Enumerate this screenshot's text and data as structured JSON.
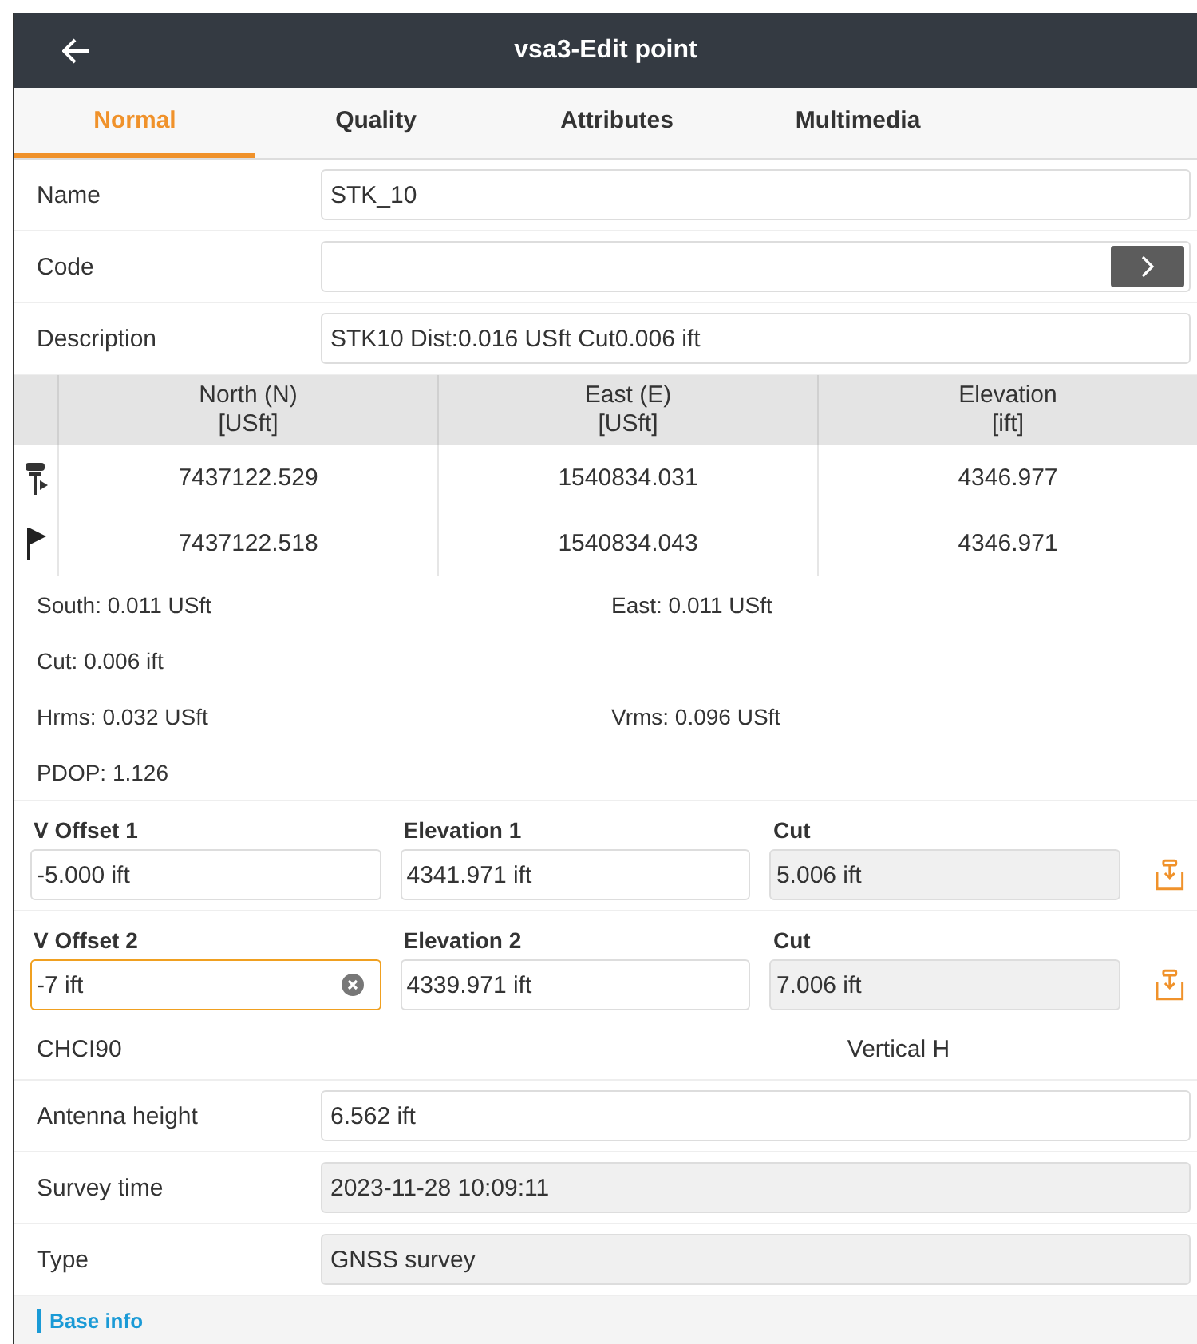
{
  "header": {
    "title": "vsa3-Edit point"
  },
  "tabs": [
    {
      "label": "Normal",
      "selected": true
    },
    {
      "label": "Quality",
      "selected": false
    },
    {
      "label": "Attributes",
      "selected": false
    },
    {
      "label": "Multimedia",
      "selected": false
    }
  ],
  "fields": [
    {
      "label": "Name",
      "value": "STK_10",
      "kind": "text",
      "disabled": false
    },
    {
      "label": "Code",
      "kind": "picker",
      "disabled": false
    },
    {
      "label": "Description",
      "value": "STK10 Dist:0.016 USft Cut0.006 ift",
      "kind": "text",
      "disabled": false
    }
  ],
  "table": {
    "columns": [
      {
        "name": "North (N)",
        "unit": "[USft]"
      },
      {
        "name": "East (E)",
        "unit": "[USft]"
      },
      {
        "name": "Elevation",
        "unit": "[ift]"
      }
    ],
    "rows": [
      {
        "kind": "rover",
        "cells": [
          "7437122.529",
          "1540834.031",
          "4346.977"
        ]
      },
      {
        "kind": "flag",
        "cells": [
          "7437122.518",
          "1540834.043",
          "4346.971"
        ]
      }
    ]
  },
  "info_lines": [
    [
      "South: 0.011 USft",
      "East: 0.011 USft"
    ],
    [
      "Cut: 0.006 ift"
    ],
    [
      "Hrms: 0.032 USft",
      "Vrms: 0.096 USft"
    ],
    [
      "PDOP: 1.126"
    ]
  ],
  "offsets": [
    {
      "offset_label": "V Offset 1",
      "offset": "-5.000 ift",
      "focused": false,
      "elevation_label": "Elevation 1",
      "elevation": "4341.971 ift",
      "cut_label": "Cut",
      "cut": "5.006 ift"
    },
    {
      "offset_label": "V Offset 2",
      "offset": "-7 ift",
      "focused": true,
      "elevation_label": "Elevation 2",
      "elevation": "4339.971 ift",
      "cut_label": "Cut",
      "cut": "7.006 ift"
    }
  ],
  "antenna": {
    "model": "CHCI90",
    "mode": "Vertical H"
  },
  "details": [
    {
      "label": "Antenna height",
      "value": "6.562 ift",
      "disabled": false
    },
    {
      "label": "Survey time",
      "value": "2023-11-28 10:09:11",
      "disabled": true
    },
    {
      "label": "Type",
      "value": "GNSS survey",
      "disabled": true
    }
  ],
  "section": {
    "title": "Base info"
  }
}
